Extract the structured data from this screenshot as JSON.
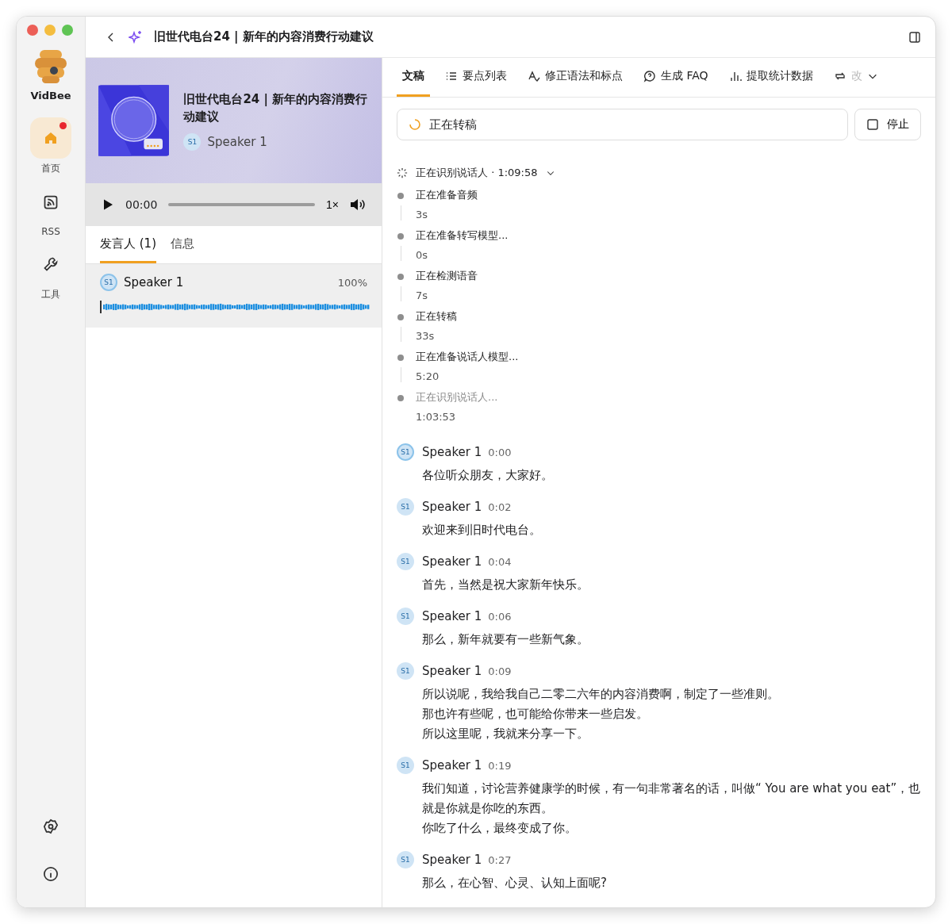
{
  "window": {
    "title": "旧世代电台24 | 新年的内容消费行动建议"
  },
  "sidebar": {
    "app_name": "VidBee",
    "items": [
      {
        "label": "首页",
        "selected": true,
        "badge": true
      },
      {
        "label": "RSS",
        "selected": false,
        "badge": false
      },
      {
        "label": "工具",
        "selected": false,
        "badge": false
      }
    ]
  },
  "episode": {
    "title": "旧世代电台24 | 新年的内容消费行动建议",
    "speaker_badge": "S1",
    "speaker": "Speaker 1"
  },
  "player": {
    "time": "00:00",
    "level": 0,
    "speed": "1×"
  },
  "left_tabs": [
    {
      "label": "发言人 (1)",
      "selected": true
    },
    {
      "label": "信息",
      "selected": false
    }
  ],
  "speakers": [
    {
      "badge": "S1",
      "name": "Speaker 1",
      "share": "100%"
    }
  ],
  "tabs": [
    {
      "label": "文稿",
      "selected": true,
      "faded": false
    },
    {
      "label": "要点列表",
      "selected": false,
      "faded": false
    },
    {
      "label": "修正语法和标点",
      "selected": false,
      "faded": false
    },
    {
      "label": "生成 FAQ",
      "selected": false,
      "faded": false
    },
    {
      "label": "提取统计数据",
      "selected": false,
      "faded": false
    },
    {
      "label": "改",
      "selected": false,
      "faded": true
    }
  ],
  "status": {
    "text": "正在转稿",
    "stop_label": "停止"
  },
  "progress": {
    "header": "正在识别说话人 · 1:09:58",
    "expanded": true,
    "steps": [
      {
        "label": "正在准备音频",
        "time": "3s",
        "done": true
      },
      {
        "label": "正在准备转写模型...",
        "time": "0s",
        "done": true
      },
      {
        "label": "正在检测语音",
        "time": "7s",
        "done": true
      },
      {
        "label": "正在转稿",
        "time": "33s",
        "done": true
      },
      {
        "label": "正在准备说话人模型...",
        "time": "5:20",
        "done": true
      },
      {
        "label": "正在识别说话人...",
        "time": "1:03:53",
        "done": false
      }
    ]
  },
  "segments": [
    {
      "badge": "S1",
      "speaker": "Speaker 1",
      "time": "0:00",
      "active": true,
      "lines": [
        "各位听众朋友，大家好。"
      ]
    },
    {
      "badge": "S1",
      "speaker": "Speaker 1",
      "time": "0:02",
      "active": false,
      "lines": [
        "欢迎来到旧时代电台。"
      ]
    },
    {
      "badge": "S1",
      "speaker": "Speaker 1",
      "time": "0:04",
      "active": false,
      "lines": [
        "首先，当然是祝大家新年快乐。"
      ]
    },
    {
      "badge": "S1",
      "speaker": "Speaker 1",
      "time": "0:06",
      "active": false,
      "lines": [
        "那么，新年就要有一些新气象。"
      ]
    },
    {
      "badge": "S1",
      "speaker": "Speaker 1",
      "time": "0:09",
      "active": false,
      "lines": [
        "所以说呢，我给我自己二零二六年的内容消费啊，制定了一些准则。",
        "那也许有些呢，也可能给你带来一些启发。",
        "所以这里呢，我就来分享一下。"
      ]
    },
    {
      "badge": "S1",
      "speaker": "Speaker 1",
      "time": "0:19",
      "active": false,
      "lines": [
        "我们知道，讨论营养健康学的时候，有一句非常著名的话，叫做“ You are what you eat”，也就是你就是你吃的东西。",
        "你吃了什么，最终变成了你。"
      ]
    },
    {
      "badge": "S1",
      "speaker": "Speaker 1",
      "time": "0:27",
      "active": false,
      "lines": [
        "那么，在心智、心灵、认知上面呢?"
      ]
    }
  ]
}
